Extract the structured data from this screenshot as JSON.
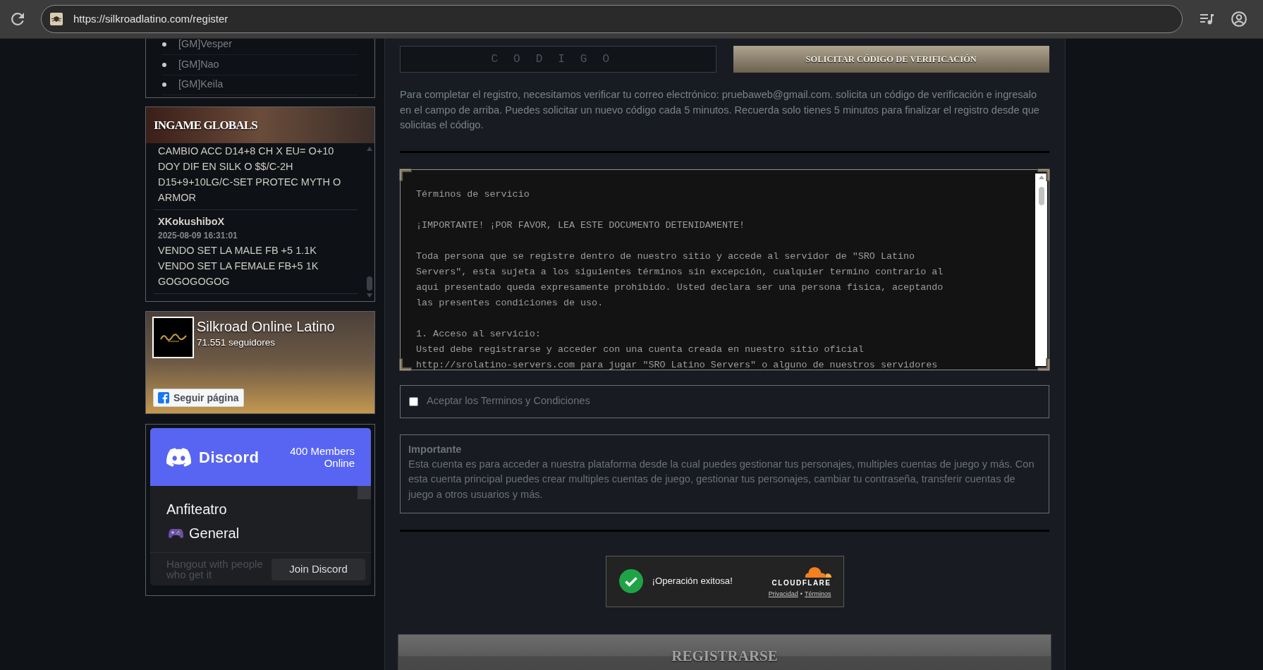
{
  "browser": {
    "url": "https://silkroadlatino.com/register"
  },
  "sidebar": {
    "staff": [
      "[GM]Vesper",
      "[GM]Nao",
      "[GM]Keila"
    ],
    "globals": {
      "title": "INGAME GLOBALS",
      "messages": [
        {
          "text": "CAMBIO ACC D14+8 CH X EU= O+10 DOY DIF EN SILK O $$/C-2H D15+9+10LG/C-SET PROTEC MYTH O ARMOR"
        },
        {
          "author": "XKokushiboX",
          "time": "2025-08-09 16:31:01",
          "text": "VENDO SET LA MALE FB +5 1.1K VENDO SET LA FEMALE FB+5 1K GOGOGOGOG"
        }
      ]
    },
    "facebook": {
      "page_name": "Silkroad Online Latino",
      "followers": "71.551 seguidores",
      "follow_button": "Seguir página"
    },
    "discord": {
      "wordmark": "Discord",
      "members_online": "400 Members Online",
      "channels": [
        {
          "name": "Anfiteatro",
          "kind": "text"
        },
        {
          "name": "General",
          "kind": "emoji"
        }
      ],
      "tagline": "Hangout with people who get it",
      "join_button": "Join Discord"
    }
  },
  "main": {
    "code_field": {
      "placeholder": "CODIGO"
    },
    "request_code_button": "SOLICITAR CÓDIGO DE VERIFICACIÓN",
    "verification_notice": "Para completar el registro, necesitamos verificar tu correo electrónico: pruebaweb@gmail.com. solicita un código de verificación e ingresalo en el campo de arriba. Puedes solicitar un nuevo código cada 5 minutos. Recuerda solo tienes 5 minutos para finalizar el registro desde que solicitas el código.",
    "terms": {
      "title": "Términos de servicio",
      "paragraphs": [
        "¡IMPORTANTE! ¡POR FAVOR, LEA ESTE DOCUMENTO DETENIDAMENTE!",
        "Toda persona que se registre dentro de nuestro sitio y accede al servidor de \"SRO Latino\nServers\", esta sujeta a los siguientes términos sin excepción, cualquier termino contrario al\naqui presentado queda expresamente prohibido. Usted declara ser una persona fisica, aceptando\nlas presentes condiciones de uso.",
        "1. Acceso al servicio:\nUsted debe registrarse y acceder con una cuenta creada en nuestro sitio oficial\nhttp://srolatino-servers.com para jugar \"SRO Latino Servers\" o alguno de nuestros servidores"
      ]
    },
    "accept_terms": {
      "label": "Aceptar los Terminos y Condiciones",
      "checked": false
    },
    "important": {
      "title": "Importante",
      "text": "Esta cuenta es para acceder a nuestra plataforma desde la cual puedes gestionar tus personajes, multiples cuentas de juego y más. Con esta cuenta principal puedes crear multiples cuentas de juego, gestionar tus personajes, cambiar tu contraseña, transferir cuentas de juego a otros usuarios y más."
    },
    "captcha": {
      "verified": true,
      "message": "¡Operación exitosa!",
      "brand": "CLOUDFLARE",
      "links": [
        "Privacidad",
        "Términos"
      ],
      "link_separator": "•"
    },
    "register_button": "REGISTRARSE"
  }
}
